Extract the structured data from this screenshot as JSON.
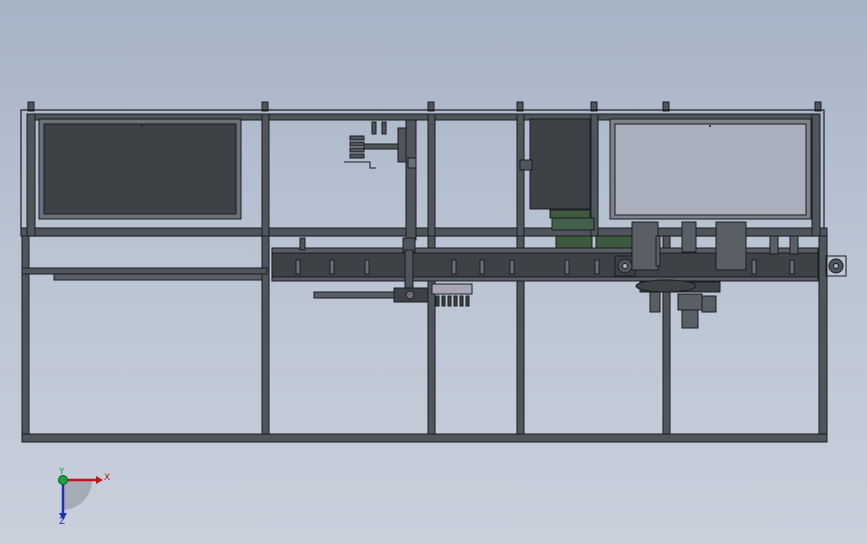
{
  "viewport": {
    "background_top": "#a6b3c6",
    "background_bottom": "#c9d0dc",
    "model_stroke": "#1a1d22",
    "frame_fill": "#50555c",
    "panel_dark": "#3e4247",
    "panel_light": "#a9afbd",
    "motor_green": "#3d5a3e"
  },
  "triad": {
    "x_label": "X",
    "y_label": "Y",
    "z_label": "Z",
    "x_color": "#c0151b",
    "y_color": "#1aa33a",
    "z_color": "#1d2fb3"
  }
}
